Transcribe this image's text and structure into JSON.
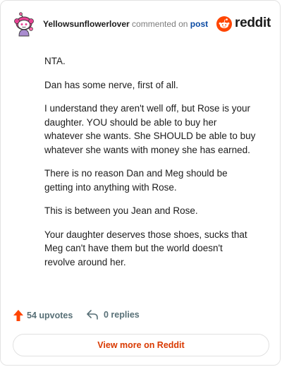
{
  "header": {
    "username": "Yellowsunflowerlover",
    "action": "commented on",
    "post_link": "post",
    "brand": "reddit"
  },
  "colors": {
    "brand_orange": "#ff4500",
    "link_blue": "#0a4aa3",
    "cta_orange": "#d93900",
    "muted": "#576f76"
  },
  "comment": {
    "paragraphs": [
      "NTA.",
      "Dan has some nerve, first of all.",
      "I understand they aren't well off, but Rose is your daughter. YOU should be able to buy her whatever she wants. She SHOULD be able to buy whatever she wants with money she has earned.",
      "There is no reason Dan and Meg should be getting into anything with Rose.",
      "This is between you Jean and Rose.",
      "Your daughter deserves those shoes, sucks that Meg can't have them but the world doesn't revolve around her."
    ]
  },
  "footer": {
    "upvotes": "54 upvotes",
    "replies": "0 replies",
    "view_more": "View more on Reddit"
  },
  "icons": {
    "avatar": "snoo-avatar-icon",
    "brand": "reddit-logo-icon",
    "upvote": "upvote-arrow-icon",
    "reply": "reply-arrow-icon"
  }
}
